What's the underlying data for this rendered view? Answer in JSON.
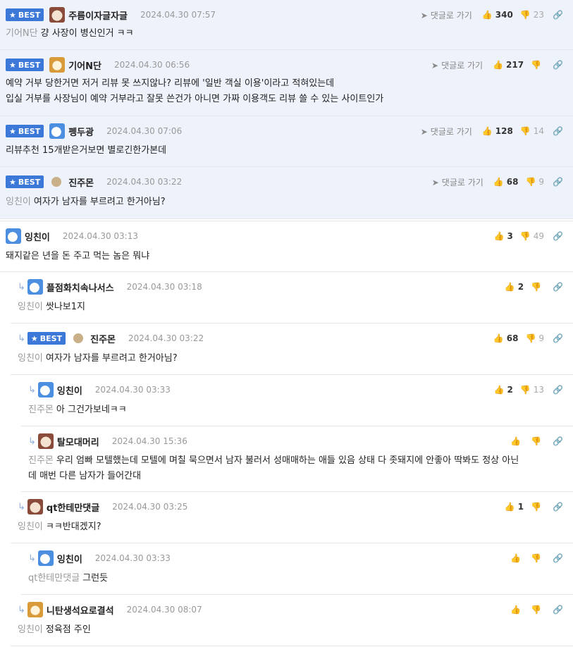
{
  "best_label": "BEST",
  "goto_label": "댓글로 가기",
  "comments": [
    {
      "nick": "주름이자글자글",
      "date": "2024.04.30 07:57",
      "up": "340",
      "down": "23",
      "mention": "기어N단",
      "text": "걍 사장이 병신인거 ㅋㅋ"
    },
    {
      "nick": "기어N단",
      "date": "2024.04.30 06:56",
      "up": "217",
      "down": "",
      "line1": "예약 거부 당한거면 저거 리뷰 못 쓰지않나? 리뷰에 '일반 객실 이용'이라고 적혀있는데",
      "line2": "입실 거부를 사장님이 예약 거부라고 잘못 쓴건가 아니면 가짜 이용객도 리뷰 쓸 수 있는 사이트인가"
    },
    {
      "nick": "펭두광",
      "date": "2024.04.30 07:06",
      "up": "128",
      "down": "14",
      "text": "리뷰추천 15개받은거보면 별로긴한가본데"
    },
    {
      "nick": "진주몬",
      "date": "2024.04.30 03:22",
      "up": "68",
      "down": "9",
      "mention": "잉친이",
      "text": "여자가 남자를 부르려고 한거아님?"
    },
    {
      "nick": "잉친이",
      "date": "2024.04.30 03:13",
      "up": "3",
      "down": "49",
      "text": "돼지같은 년을 돈 주고 먹는 놈은 뭐냐"
    },
    {
      "nick": "플점화치속나서스",
      "date": "2024.04.30 03:18",
      "up": "2",
      "down": "",
      "mention": "잉친이",
      "text": "쌋나보1지"
    },
    {
      "nick": "진주몬",
      "date": "2024.04.30 03:22",
      "up": "68",
      "down": "9",
      "mention": "잉친이",
      "text": "여자가 남자를 부르려고 한거아님?"
    },
    {
      "nick": "잉친이",
      "date": "2024.04.30 03:33",
      "up": "2",
      "down": "13",
      "mention": "진주몬",
      "text": "아 그건가보네ㅋㅋ"
    },
    {
      "nick": "탈모대머리",
      "date": "2024.04.30 15:36",
      "up": "",
      "down": "",
      "mention": "진주몬",
      "line1": "우리 엄빠 모텔했는데 모텔에 며칠 묵으면서 남자 불러서 성매매하는 애들 있음 상태 다 좃돼지에 안좋아 딱봐도 정상 아닌",
      "line2": "데 매번 다른 남자가 들어간대"
    },
    {
      "nick": "qt한테만댓글",
      "date": "2024.04.30 03:25",
      "up": "1",
      "down": "",
      "mention": "잉친이",
      "text": "ㅋㅋ반대겠지?"
    },
    {
      "nick": "잉친이",
      "date": "2024.04.30 03:33",
      "up": "",
      "down": "",
      "mention": "qt한테만댓글",
      "text": "그런듯"
    },
    {
      "nick": "니탄생석요로결석",
      "date": "2024.04.30 08:07",
      "up": "",
      "down": "",
      "mention": "잉친이",
      "text": "정육점 주인"
    }
  ]
}
